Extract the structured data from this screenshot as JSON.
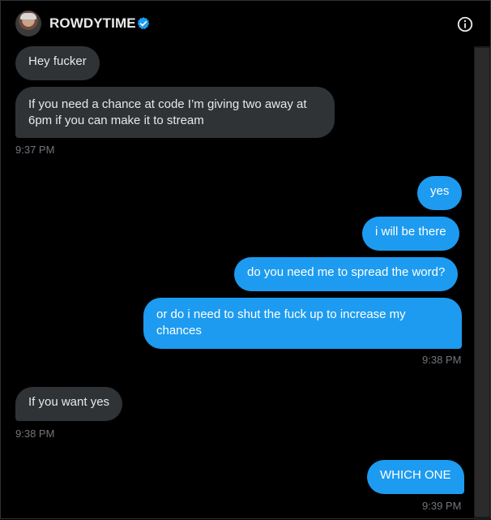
{
  "header": {
    "name": "ROWDYTIME",
    "verified_icon": "verified-badge-icon",
    "info_icon": "info-circle-icon",
    "avatar_icon": "user-avatar"
  },
  "colors": {
    "background": "#000000",
    "incoming_bubble": "#2f3336",
    "outgoing_bubble": "#1d9bf0",
    "timestamp": "#71767b",
    "text": "#e7e9ea"
  },
  "messages": [
    {
      "direction": "incoming",
      "text": "Hey fucker"
    },
    {
      "direction": "incoming",
      "text": "If you need a chance at code I’m giving two away at 6pm if you can make it to stream",
      "time": "9:37 PM"
    },
    {
      "direction": "outgoing",
      "text": "yes"
    },
    {
      "direction": "outgoing",
      "text": "i will be there"
    },
    {
      "direction": "outgoing",
      "text": "do you need me to spread the word?"
    },
    {
      "direction": "outgoing",
      "text": "or do i need to shut the fuck up to increase my chances",
      "time": "9:38 PM"
    },
    {
      "direction": "incoming",
      "text": "If you want yes",
      "time": "9:38 PM"
    },
    {
      "direction": "outgoing",
      "text": "WHICH ONE",
      "time": "9:39 PM"
    }
  ]
}
